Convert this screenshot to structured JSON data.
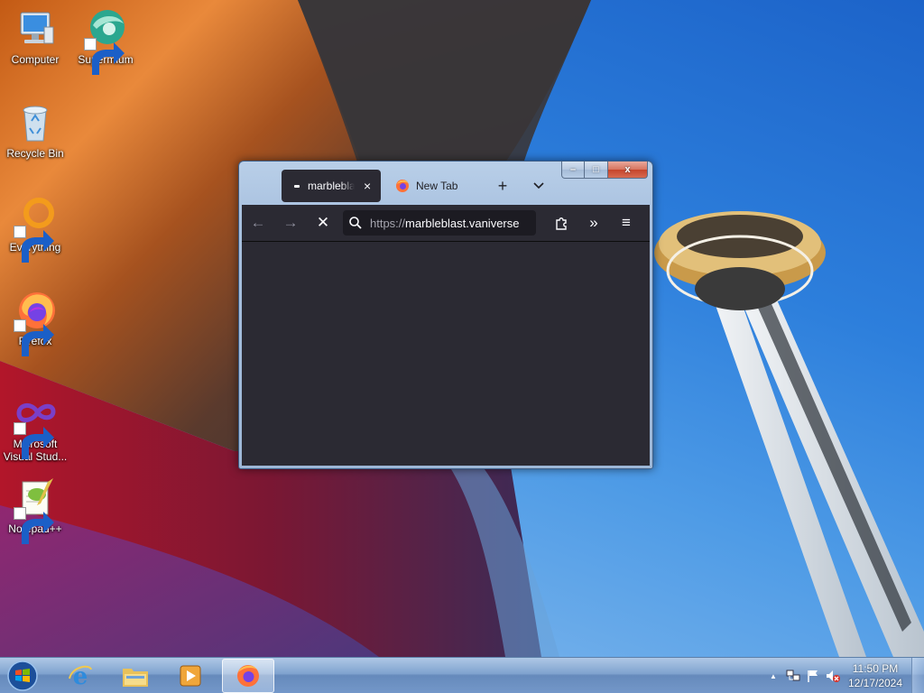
{
  "desktop": {
    "icons": [
      {
        "label": "Computer",
        "icon": "computer-icon"
      },
      {
        "label": "Supermium",
        "icon": "supermium-icon"
      },
      {
        "label": "Recycle Bin",
        "icon": "recycle-bin-icon"
      },
      {
        "label": "Everything",
        "icon": "everything-icon"
      },
      {
        "label": "Firefox",
        "icon": "firefox-icon"
      },
      {
        "label": "Microsoft Visual Stud...",
        "icon": "visual-studio-icon"
      },
      {
        "label": "Notepad++",
        "icon": "notepadpp-icon"
      }
    ]
  },
  "browser": {
    "tabs": [
      {
        "title": "marbleblast.vaniverse",
        "close": "×",
        "active": true
      },
      {
        "title": "New Tab",
        "active": false
      }
    ],
    "new_tab_symbol": "+",
    "tab_list_symbol": "⌄",
    "nav": {
      "back": "←",
      "forward": "→",
      "stop": "✕",
      "url_prefix": "https://",
      "url_host": "marbleblast.vaniverse",
      "overflow": "»",
      "menu": "≡"
    },
    "window_controls": {
      "minimize": "–",
      "maximize": "□",
      "close": "x"
    }
  },
  "taskbar": {
    "items": [
      "start-orb",
      "internet-explorer",
      "file-explorer",
      "media-player",
      "firefox"
    ],
    "active_item": "firefox",
    "clock": {
      "time": "11:50 PM",
      "date": "12/17/2024"
    },
    "tray": {
      "show_hidden": "▲"
    }
  },
  "colors": {
    "browser_toolbar": "#2b2a33",
    "urlbar_bg": "#1c1b22",
    "sky_blue": "#2d7fdc",
    "firefox_orange": "#ff7139"
  }
}
